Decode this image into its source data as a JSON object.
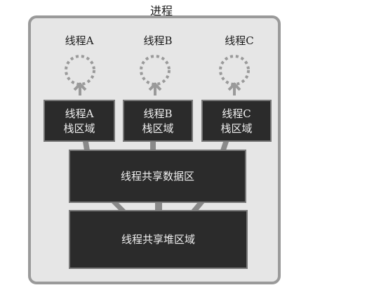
{
  "process": {
    "title": "进程"
  },
  "threads": [
    {
      "name": "线程A",
      "stack_line1": "线程A",
      "stack_line2": "栈区域"
    },
    {
      "name": "线程B",
      "stack_line1": "线程B",
      "stack_line2": "栈区域"
    },
    {
      "name": "线程C",
      "stack_line1": "线程C",
      "stack_line2": "栈区域"
    }
  ],
  "shared": {
    "data_area": "线程共享数据区",
    "heap_area": "线程共享堆区域"
  },
  "colors": {
    "process_bg": "#e6e6e6",
    "process_border": "#9a9a9a",
    "block_fill": "#2b2b2b",
    "block_text": "#f0f0f0",
    "thread_icon": "#9a9a9a"
  }
}
